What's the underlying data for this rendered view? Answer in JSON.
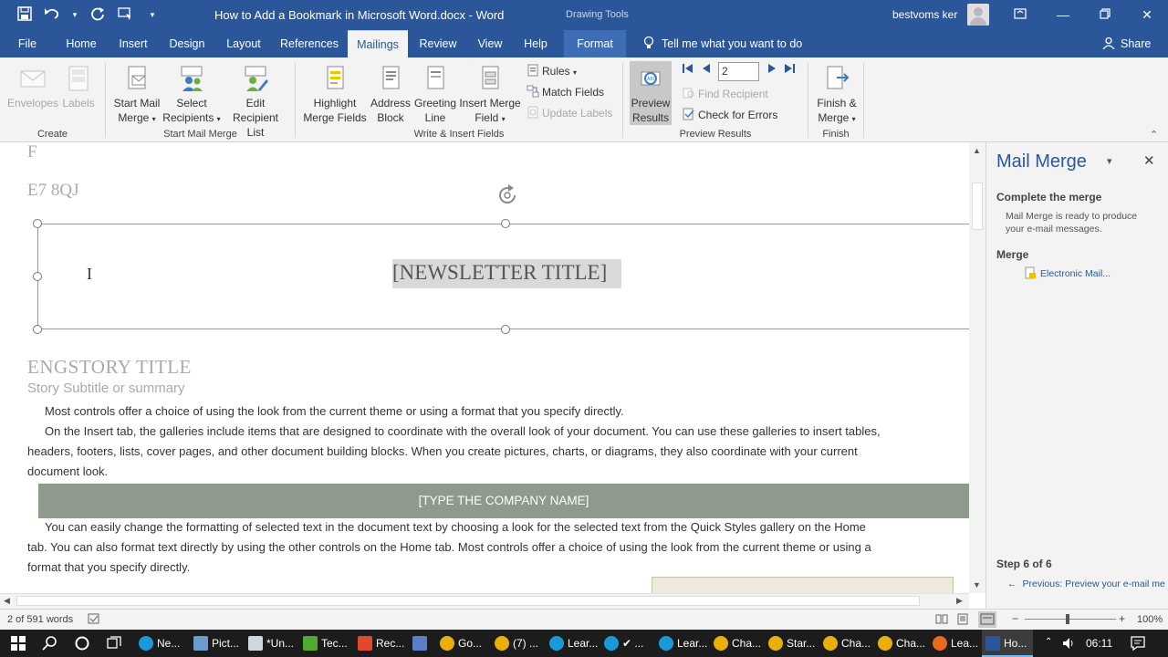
{
  "titlebar": {
    "doc_title": "How to Add a Bookmark in Microsoft Word.docx  -  Word",
    "context_label": "Drawing Tools",
    "user_name": "bestvoms ker"
  },
  "tabs": {
    "file": "File",
    "home": "Home",
    "insert": "Insert",
    "design": "Design",
    "layout": "Layout",
    "references": "References",
    "mailings": "Mailings",
    "review": "Review",
    "view": "View",
    "help": "Help",
    "format": "Format",
    "tell_me": "Tell me what you want to do",
    "share": "Share"
  },
  "ribbon": {
    "create": {
      "label": "Create",
      "envelopes": "Envelopes",
      "labels": "Labels"
    },
    "start_mail_merge": {
      "label": "Start Mail Merge",
      "start_line1": "Start Mail",
      "start_line2": "Merge",
      "select_line1": "Select",
      "select_line2": "Recipients",
      "edit_line1": "Edit",
      "edit_line2": "Recipient List"
    },
    "write_insert": {
      "label": "Write & Insert Fields",
      "highlight_line1": "Highlight",
      "highlight_line2": "Merge Fields",
      "address_line1": "Address",
      "address_line2": "Block",
      "greeting_line1": "Greeting",
      "greeting_line2": "Line",
      "insert_line1": "Insert Merge",
      "insert_line2": "Field",
      "rules": "Rules",
      "match_fields": "Match Fields",
      "update_labels": "Update Labels"
    },
    "preview": {
      "label": "Preview Results",
      "preview_line1": "Preview",
      "preview_line2": "Results",
      "record": "2",
      "find_recipient": "Find Recipient",
      "check_errors": "Check for Errors"
    },
    "finish": {
      "label": "Finish",
      "finish_line1": "Finish &",
      "finish_line2": "Merge"
    }
  },
  "document": {
    "line_f": "F",
    "postcode": "E7 8QJ",
    "newsletter_title": "[NEWSLETTER TITLE]",
    "story_title": "ENGSTORY TITLE",
    "story_subtitle": "Story Subtitle or summary",
    "para1": "Most controls offer a choice of using the look from the current theme or using a format that you specify directly.",
    "para2_line1": "On the Insert tab, the galleries include items that are designed to coordinate with the overall look of your document. You can use these galleries to insert tables,",
    "para2_line2": "headers, footers, lists, cover pages, and other document building blocks. When you create pictures, charts, or diagrams, they also coordinate with your current",
    "para2_line3": "document look.",
    "company_banner": "[TYPE THE COMPANY NAME]",
    "para3_line1": "You can easily change the formatting of selected text in the document text by choosing a look for the selected text from the Quick Styles gallery on the Home",
    "para3_line2": "tab. You can also format text directly by using the other controls on the Home tab. Most controls offer a choice of using the look from the current theme or using a",
    "para3_line3": "format that you specify directly."
  },
  "pane": {
    "title": "Mail Merge",
    "section_complete": "Complete the merge",
    "complete_desc_line1": "Mail Merge is ready to produce",
    "complete_desc_line2": "your e-mail messages.",
    "section_merge": "Merge",
    "electronic_mail": "Electronic Mail...",
    "step": "Step 6 of 6",
    "previous": "Previous: Preview your e-mail me"
  },
  "status": {
    "words": "2 of 591 words",
    "zoom": "100%"
  },
  "taskbar": {
    "items": [
      "Ne...",
      "Pict...",
      "*Un...",
      "Tec...",
      "Rec...",
      "",
      "Go...",
      "(7) ...",
      "Lear...",
      "✔ ...",
      "Lear...",
      "Cha...",
      "Star...",
      "Cha...",
      "Cha...",
      "Lea...",
      "Ho..."
    ],
    "time": "06:11"
  },
  "colors": {
    "word_blue": "#2b579a",
    "banner_gray": "#8e9a8c",
    "taskbar": "#1c1c1c"
  }
}
